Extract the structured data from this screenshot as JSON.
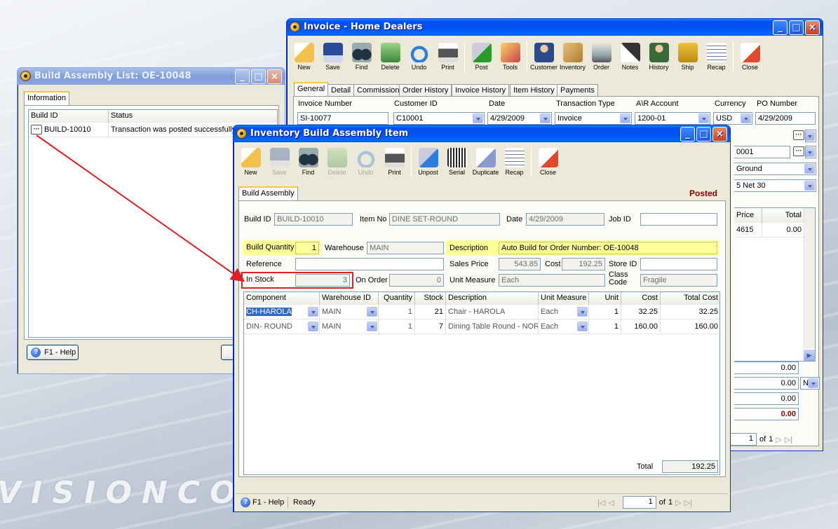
{
  "background": {
    "logo_text": "VISIONCORE"
  },
  "invoice_window": {
    "title": "Invoice - Home Dealers",
    "toolbar": [
      {
        "label": "New",
        "icon": "new-document-icon"
      },
      {
        "label": "Save",
        "icon": "floppy-disk-icon"
      },
      {
        "label": "Find",
        "icon": "binoculars-icon"
      },
      {
        "label": "Delete",
        "icon": "recycle-bin-icon"
      },
      {
        "label": "Undo",
        "icon": "undo-arrow-icon"
      },
      {
        "label": "Print",
        "icon": "printer-icon"
      },
      {
        "label": "Post",
        "icon": "post-checkmark-icon"
      },
      {
        "label": "Tools",
        "icon": "tools-icon"
      },
      {
        "label": "Customer",
        "icon": "customer-person-icon"
      },
      {
        "label": "Inventory",
        "icon": "boxes-icon"
      },
      {
        "label": "Order",
        "icon": "order-device-icon"
      },
      {
        "label": "Notes",
        "icon": "notes-pen-icon"
      },
      {
        "label": "History",
        "icon": "history-people-icon"
      },
      {
        "label": "Ship",
        "icon": "forklift-icon"
      },
      {
        "label": "Recap",
        "icon": "recap-sheet-icon"
      },
      {
        "label": "Close",
        "icon": "close-window-icon"
      }
    ],
    "tabs": [
      "General",
      "Detail",
      "Commission",
      "Order History",
      "Invoice History",
      "Item History",
      "Payments"
    ],
    "fields": {
      "invoice_number_label": "Invoice Number",
      "invoice_number": "SI-10077",
      "customer_id_label": "Customer ID",
      "customer_id": "C10001",
      "date_label": "Date",
      "date": "4/29/2009",
      "transaction_type_label": "Transaction Type",
      "transaction_type": "Invoice",
      "ar_account_label": "A\\R Account",
      "ar_account": "1200-01",
      "currency_label": "Currency",
      "currency": "USD",
      "po_number_label": "PO Number",
      "po_number": "4/29/2009",
      "partial_1": "0001",
      "partial_2": "Ground",
      "partial_3": "5 Net 30"
    },
    "grid_headers": {
      "price": "Price",
      "total": "Total"
    },
    "grid_row": {
      "price": "4615",
      "total": "0.00"
    },
    "totals": [
      "0.00",
      "0.00",
      "0.00",
      "0.00"
    ],
    "currency_small": "N",
    "pager": {
      "page": "1",
      "of_label": "of",
      "total": "1"
    }
  },
  "list_window": {
    "title": "Build Assembly List: OE-10048",
    "tab": "Information",
    "columns": [
      "Build ID",
      "Status"
    ],
    "rows": [
      {
        "build_id": "BUILD-10010",
        "status": "Transaction was posted successfully!"
      }
    ],
    "help_button": "F1 - Help"
  },
  "build_window": {
    "title": "Inventory Build Assembly Item",
    "toolbar": [
      {
        "label": "New",
        "icon": "new-document-icon",
        "enabled": true
      },
      {
        "label": "Save",
        "icon": "floppy-disk-icon",
        "enabled": false
      },
      {
        "label": "Find",
        "icon": "binoculars-icon",
        "enabled": true
      },
      {
        "label": "Delete",
        "icon": "recycle-bin-icon",
        "enabled": false
      },
      {
        "label": "Undo",
        "icon": "undo-arrow-icon",
        "enabled": false
      },
      {
        "label": "Print",
        "icon": "printer-icon",
        "enabled": true
      },
      {
        "label": "Unpost",
        "icon": "unpost-icon",
        "enabled": true
      },
      {
        "label": "Serial",
        "icon": "barcode-icon",
        "enabled": true
      },
      {
        "label": "Duplicate",
        "icon": "duplicate-pages-icon",
        "enabled": true
      },
      {
        "label": "Recap",
        "icon": "recap-sheet-icon",
        "enabled": true
      },
      {
        "label": "Close",
        "icon": "close-window-icon",
        "enabled": true
      }
    ],
    "tab": "Build Assembly",
    "status_badge": "Posted",
    "fields": {
      "build_id_label": "Build ID",
      "build_id": "BUILD-10010",
      "item_no_label": "Item No",
      "item_no": "DINE SET-ROUND",
      "date_label": "Date",
      "date": "4/29/2009",
      "job_id_label": "Job ID",
      "job_id": "",
      "build_qty_label": "Build Quantity",
      "build_qty": "1",
      "warehouse_label": "Warehouse",
      "warehouse": "MAIN",
      "description_label": "Description",
      "description": "Auto Build for Order Number: OE-10048",
      "reference_label": "Reference",
      "reference": "",
      "sales_price_label": "Sales Price",
      "sales_price": "543.85",
      "cost_label": "Cost",
      "cost": "192.25",
      "store_id_label": "Store ID",
      "store_id": "",
      "in_stock_label": "In Stock",
      "in_stock": "3",
      "on_order_label": "On Order",
      "on_order": "0",
      "unit_measure_label": "Unit Measure",
      "unit_measure": "Each",
      "class_code_label_1": "Class",
      "class_code_label_2": "Code",
      "class_code": "Fragile"
    },
    "grid_columns": [
      "Component",
      "Warehouse ID",
      "Quantity",
      "Stock",
      "Description",
      "Unit Measure",
      "Unit",
      "Cost",
      "Total Cost"
    ],
    "grid_rows": [
      {
        "component": "CH-HAROLA",
        "warehouse": "MAIN",
        "quantity": "1",
        "stock": "21",
        "description": "Chair - HAROLA",
        "unit_measure": "Each",
        "unit": "1",
        "cost": "32.25",
        "total_cost": "32.25"
      },
      {
        "component": "DIN- ROUND",
        "warehouse": "MAIN",
        "quantity": "1",
        "stock": "7",
        "description": "Dining Table Round - NORI",
        "unit_measure": "Each",
        "unit": "1",
        "cost": "160.00",
        "total_cost": "160.00"
      }
    ],
    "total_label": "Total",
    "total_value": "192.25",
    "help_button": "F1 - Help",
    "status_text": "Ready",
    "pager": {
      "page": "1",
      "of_label": "of",
      "total": "1"
    }
  }
}
